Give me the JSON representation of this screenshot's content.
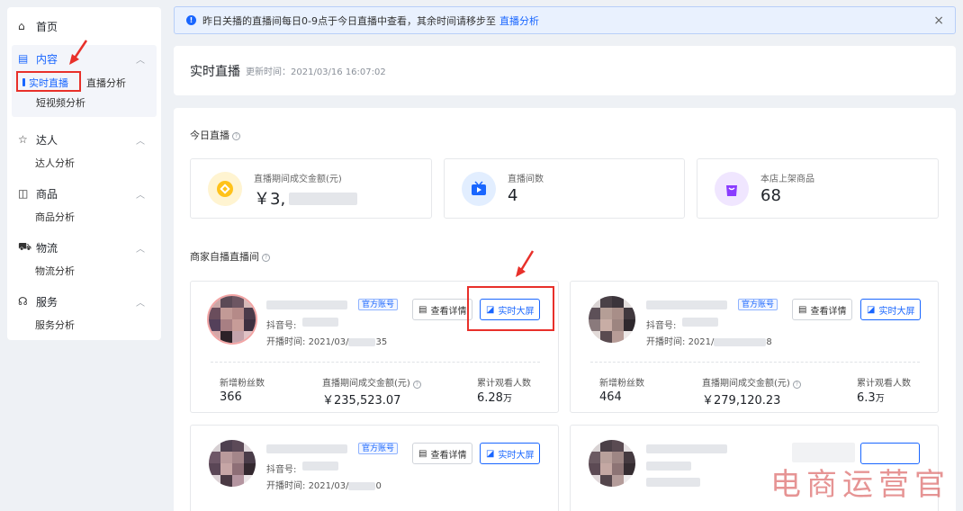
{
  "sidebar": {
    "home": "首页",
    "content": {
      "title": "内容",
      "items": [
        "实时直播",
        "直播分析",
        "短视频分析"
      ]
    },
    "talent": {
      "title": "达人",
      "items": [
        "达人分析"
      ]
    },
    "goods": {
      "title": "商品",
      "items": [
        "商品分析"
      ]
    },
    "logistics": {
      "title": "物流",
      "items": [
        "物流分析"
      ]
    },
    "service": {
      "title": "服务",
      "items": [
        "服务分析"
      ]
    }
  },
  "notice": {
    "text": "昨日关播的直播间每日0-9点于今日直播中查看，其余时间请移步至",
    "link": "直播分析",
    "close": "×"
  },
  "header": {
    "title": "实时直播",
    "update_label": "更新时间：",
    "update_time": "2021/03/16 16:07:02"
  },
  "today": {
    "title": "今日直播",
    "stats": [
      {
        "label": "直播期间成交金额(元)",
        "value": "￥3,"
      },
      {
        "label": "直播间数",
        "value": "4"
      },
      {
        "label": "本店上架商品",
        "value": "68"
      }
    ]
  },
  "rooms": {
    "title": "商家自播直播间",
    "tag": "官方账号",
    "detail_btn": "查看详情",
    "screen_btn": "实时大屏",
    "douyin_label": "抖音号:",
    "start_label": "开播时间:",
    "metric_labels": [
      "新增粉丝数",
      "直播期间成交金额(元)",
      "累计观看人数"
    ],
    "cards": [
      {
        "start": "2021/03/",
        "start_tail": "35",
        "fans": "366",
        "amount": "￥235,523.07",
        "viewers": "6.28",
        "viewers_unit": "万"
      },
      {
        "start": "2021/",
        "start_tail": "8",
        "fans": "464",
        "amount": "￥279,120.23",
        "viewers": "6.3",
        "viewers_unit": "万"
      },
      {
        "start": "2021/03/",
        "start_tail": "0"
      },
      {
        "start": "",
        "start_tail": ""
      }
    ]
  },
  "watermark": "电商运营官",
  "colors": {
    "accent": "#1966ff",
    "highlight": "#e8302a"
  }
}
